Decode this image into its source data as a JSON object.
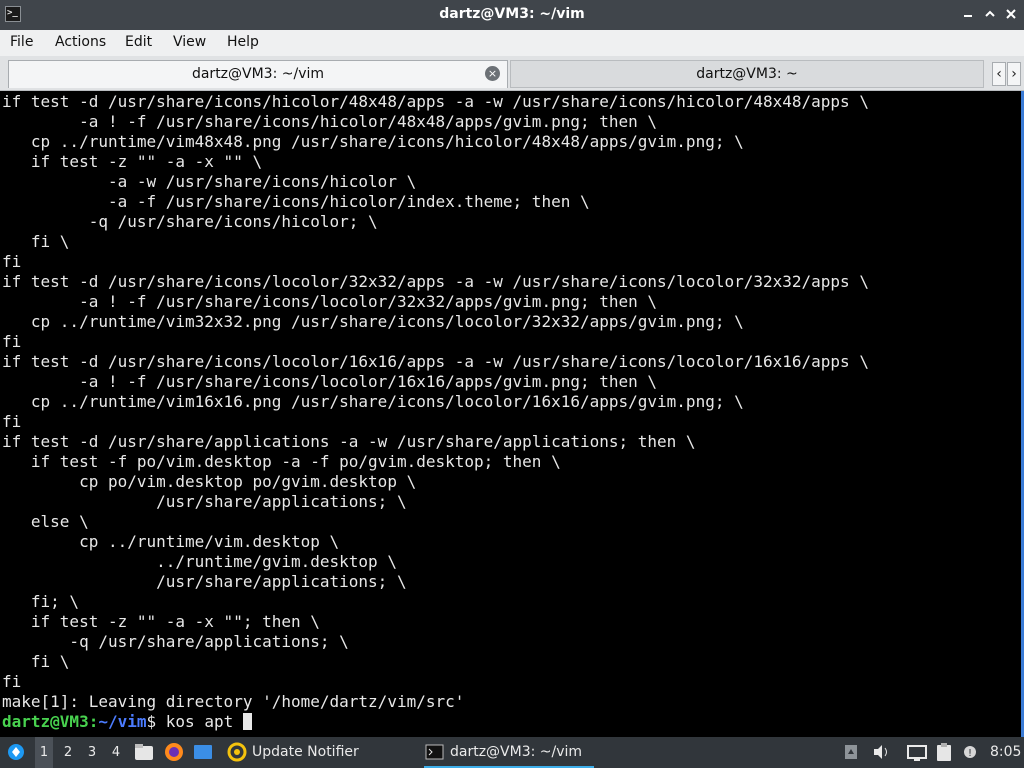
{
  "window": {
    "app_icon": ">_",
    "title": "dartz@VM3: ~/vim",
    "controls": {
      "minimize": "_",
      "maximize": "□",
      "close": "×"
    }
  },
  "menu": [
    "File",
    "Actions",
    "Edit",
    "View",
    "Help"
  ],
  "tabs": [
    {
      "label": "dartz@VM3: ~/vim",
      "active": true,
      "close": "×"
    },
    {
      "label": "dartz@VM3: ~",
      "active": false
    }
  ],
  "tab_scroll": {
    "left": "‹",
    "right": "›"
  },
  "terminal": {
    "lines": [
      "if test -d /usr/share/icons/hicolor/48x48/apps -a -w /usr/share/icons/hicolor/48x48/apps \\",
      "        -a ! -f /usr/share/icons/hicolor/48x48/apps/gvim.png; then \\",
      "   cp ../runtime/vim48x48.png /usr/share/icons/hicolor/48x48/apps/gvim.png; \\",
      "   if test -z \"\" -a -x \"\" \\",
      "           -a -w /usr/share/icons/hicolor \\",
      "           -a -f /usr/share/icons/hicolor/index.theme; then \\",
      "         -q /usr/share/icons/hicolor; \\",
      "   fi \\",
      "fi",
      "if test -d /usr/share/icons/locolor/32x32/apps -a -w /usr/share/icons/locolor/32x32/apps \\",
      "        -a ! -f /usr/share/icons/locolor/32x32/apps/gvim.png; then \\",
      "   cp ../runtime/vim32x32.png /usr/share/icons/locolor/32x32/apps/gvim.png; \\",
      "fi",
      "if test -d /usr/share/icons/locolor/16x16/apps -a -w /usr/share/icons/locolor/16x16/apps \\",
      "        -a ! -f /usr/share/icons/locolor/16x16/apps/gvim.png; then \\",
      "   cp ../runtime/vim16x16.png /usr/share/icons/locolor/16x16/apps/gvim.png; \\",
      "fi",
      "if test -d /usr/share/applications -a -w /usr/share/applications; then \\",
      "   if test -f po/vim.desktop -a -f po/gvim.desktop; then \\",
      "        cp po/vim.desktop po/gvim.desktop \\",
      "                /usr/share/applications; \\",
      "   else \\",
      "        cp ../runtime/vim.desktop \\",
      "                ../runtime/gvim.desktop \\",
      "                /usr/share/applications; \\",
      "   fi; \\",
      "   if test -z \"\" -a -x \"\"; then \\",
      "       -q /usr/share/applications; \\",
      "   fi \\",
      "fi",
      "make[1]: Leaving directory '/home/dartz/vim/src'"
    ],
    "prompt": {
      "user_host": "dartz@VM3",
      "separator": ":",
      "path": "~/vim",
      "symbol": "$",
      "command": " kos apt "
    }
  },
  "taskbar": {
    "desktops": [
      "1",
      "2",
      "3",
      "4"
    ],
    "active_desktop": "1",
    "tasks": [
      {
        "label": "Update Notifier",
        "icon": "update-notifier-icon"
      },
      {
        "label": "dartz@VM3: ~/vim",
        "icon": "terminal-icon",
        "active": true
      }
    ],
    "clock": "8:05"
  },
  "colors": {
    "titlebar": "#40454b",
    "terminal_bg": "#000000",
    "terminal_fg": "#e8e8e8",
    "prompt_user": "#48d24f",
    "prompt_path": "#4c7cff",
    "taskbar": "#31363b",
    "accent": "#3daee9"
  }
}
